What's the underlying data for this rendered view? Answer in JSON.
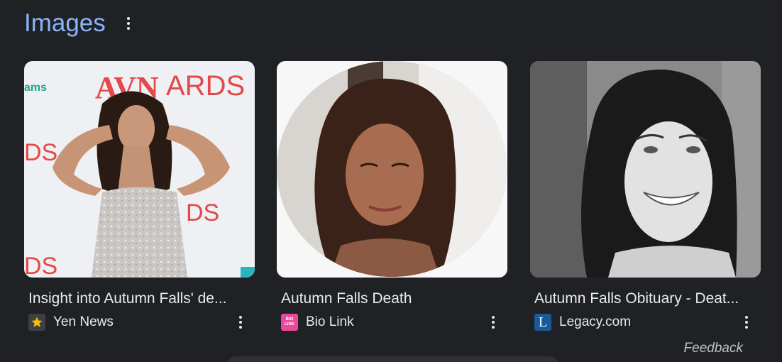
{
  "section": {
    "title": "Images"
  },
  "cards": [
    {
      "title": "Insight into Autumn Falls' de...",
      "source": "Yen News",
      "favicon_icon": "star-icon",
      "favicon_color": "#3c4043",
      "favicon_accent": "#fbbc04"
    },
    {
      "title": "Autumn Falls Death",
      "source": "Bio Link",
      "favicon_icon": "bio-link-logo",
      "favicon_color": "#ec4899",
      "favicon_text": "BIO LINK"
    },
    {
      "title": "Autumn Falls Obituary - Deat...",
      "source": "Legacy.com",
      "favicon_icon": "legacy-logo",
      "favicon_color": "#1a5a9a",
      "favicon_text": "L"
    }
  ],
  "feedback_label": "Feedback",
  "colors": {
    "background": "#202124",
    "title_accent": "#8ab4f8",
    "text": "#e8eaed"
  }
}
